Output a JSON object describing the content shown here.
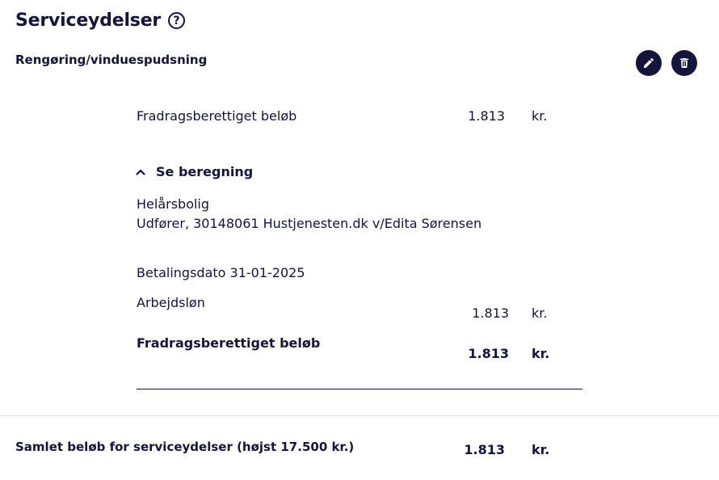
{
  "header": {
    "title": "Serviceydelser",
    "help_glyph": "?"
  },
  "section": {
    "heading": "Rengøring/vinduespudsning",
    "edit_icon": "pencil-icon",
    "delete_icon": "trash-icon"
  },
  "summary": {
    "label": "Fradragsberettiget beløb",
    "amount": "1.813",
    "currency": "kr."
  },
  "calculation": {
    "toggle_label": "Se beregning",
    "toggle_icon": "chevron-up-icon",
    "property_type": "Helårsbolig",
    "performer": "Udfører, 30148061 Hustjenesten.dk v/Edita Sørensen",
    "payment_date": "Betalingsdato 31-01-2025",
    "wages_label": "Arbejdsløn",
    "wages_amount": "1.813",
    "wages_currency": "kr.",
    "deductible_label": "Fradragsberettiget beløb",
    "deductible_amount": "1.813",
    "deductible_currency": "kr."
  },
  "total": {
    "label": "Samlet beløb for serviceydelser (højst 17.500 kr.)",
    "amount": "1.813",
    "currency": "kr."
  },
  "colors": {
    "primary": "#14143c",
    "divider": "#dcdce4",
    "background": "#ffffff"
  }
}
